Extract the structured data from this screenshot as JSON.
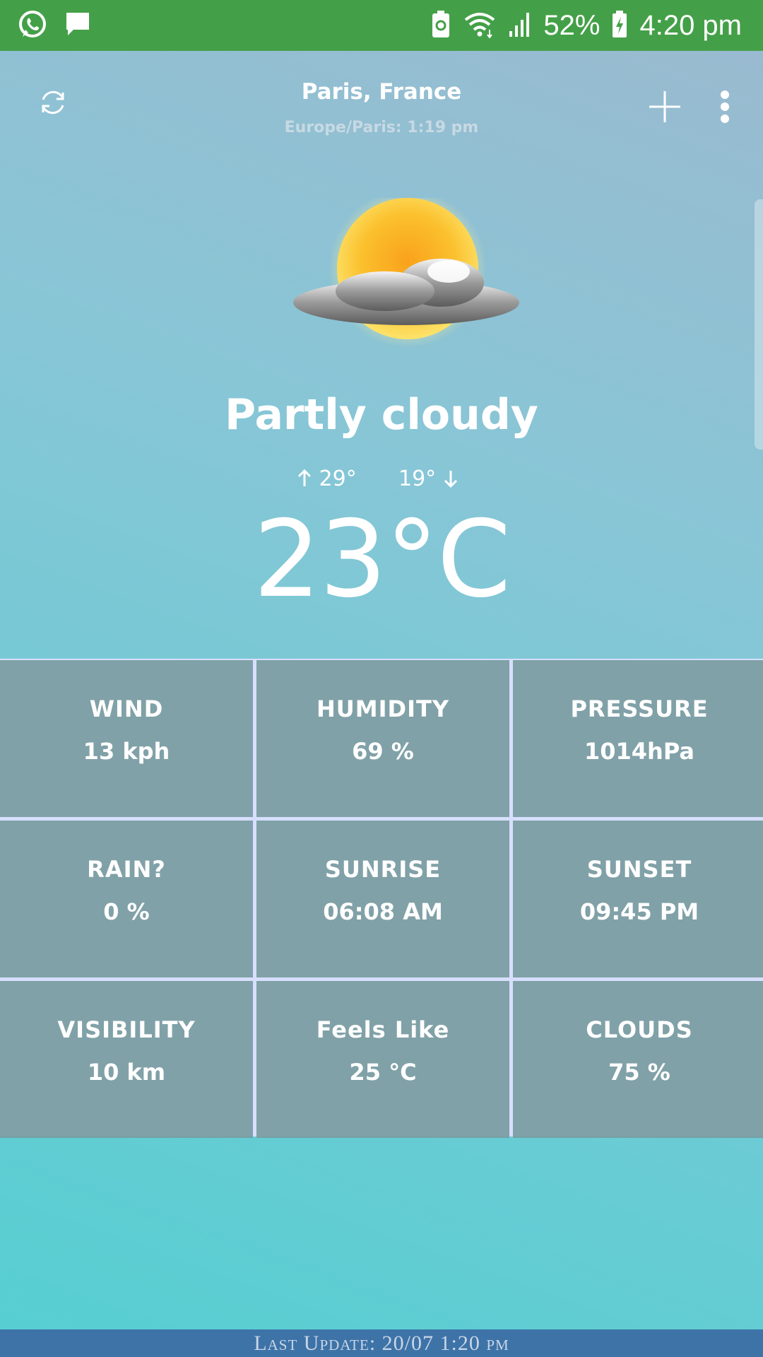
{
  "status_bar": {
    "battery_percent": "52%",
    "time": "4:20 pm",
    "icons": [
      "whatsapp-icon",
      "message-icon",
      "battery-saver-icon",
      "wifi-icon",
      "signal-icon",
      "battery-charging-icon"
    ]
  },
  "header": {
    "location": "Paris, France",
    "timezone": "Europe/Paris: 1:19 pm",
    "icons": [
      "refresh-icon",
      "add-icon",
      "more-vert-icon"
    ]
  },
  "weather": {
    "condition": "Partly cloudy",
    "high": "29°",
    "low": "19°",
    "temperature": "23°C",
    "icon": "partly-cloudy-icon"
  },
  "details": [
    {
      "label": "WIND",
      "value": "13 kph"
    },
    {
      "label": "HUMIDITY",
      "value": "69 %"
    },
    {
      "label": "PRESSURE",
      "value": "1014hPa"
    },
    {
      "label": "RAIN?",
      "value": "0 %"
    },
    {
      "label": "SUNRISE",
      "value": "06:08 AM"
    },
    {
      "label": "SUNSET",
      "value": "09:45 PM"
    },
    {
      "label": "VISIBILITY",
      "value": "10 km"
    },
    {
      "label": "Feels Like",
      "value": "25 °C"
    },
    {
      "label": "CLOUDS",
      "value": "75 %"
    }
  ],
  "footer": {
    "text": "Last Update:  20/07  1:20 pm"
  },
  "colors": {
    "status_bar": "#44a048",
    "footer": "#3e73a8",
    "grid_line": "#d7dfff",
    "cell": "#789ba0"
  }
}
